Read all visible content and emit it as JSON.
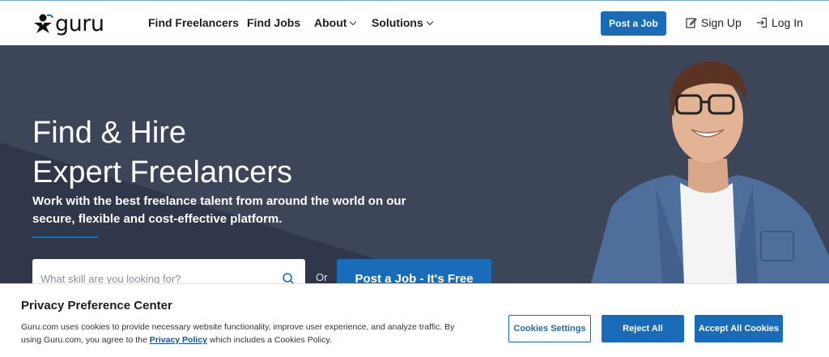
{
  "header": {
    "logo_text": "guru",
    "nav": {
      "find_freelancers": "Find Freelancers",
      "find_jobs": "Find Jobs",
      "about": "About",
      "solutions": "Solutions"
    },
    "post_job_label": "Post a Job",
    "sign_up_label": "Sign Up",
    "log_in_label": "Log In"
  },
  "hero": {
    "title_line1": "Find & Hire",
    "title_line2": "Expert Freelancers",
    "subtitle": "Work with the best freelance talent from around the world on our secure, flexible and cost-effective platform.",
    "search_placeholder": "What skill are you looking for?",
    "or_label": "Or",
    "post_job_free_label": "Post a Job - It's Free"
  },
  "cookie_banner": {
    "title": "Privacy Preference Center",
    "text_before_link": "Guru.com uses cookies to provide necessary website functionality, improve user experience, and analyze traffic. By using Guru.com, you agree to the ",
    "link_label": "Privacy Policy",
    "text_after_link": " which includes a Cookies Policy.",
    "settings_label": "Cookies Settings",
    "reject_label": "Reject All",
    "accept_label": "Accept All Cookies"
  },
  "icons": {
    "logo": "guru-figure-icon",
    "sign_up": "edit-icon",
    "log_in": "login-icon",
    "search": "search-icon"
  },
  "colors": {
    "brand_blue": "#1a6bb8",
    "hero_bg": "#363e50"
  }
}
